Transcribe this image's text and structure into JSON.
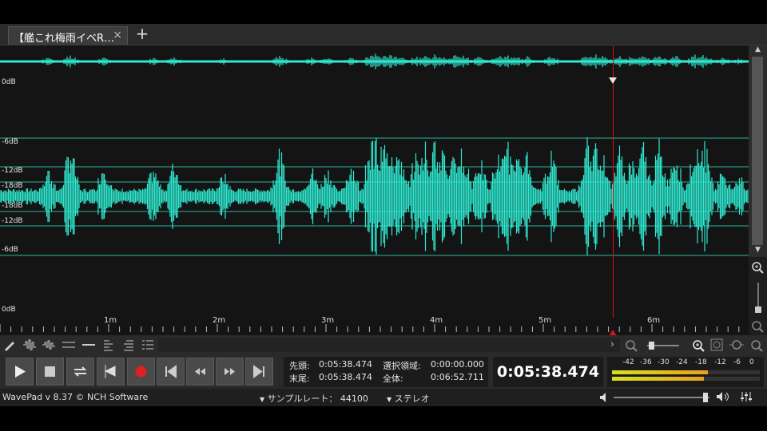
{
  "tabs": [
    {
      "label": "【艦これ梅雨イベR…",
      "close": "×"
    }
  ],
  "add_tab": "+",
  "db_labels": {
    "top_0db": "0dB",
    "neg6_upper": "-6dB",
    "neg12_upper": "-12dB",
    "neg18_upper": "-18dB",
    "neg18_lower": "-18dB",
    "neg12_lower": "-12dB",
    "neg6_lower": "-6dB",
    "bottom_0db": "0dB"
  },
  "ruler": {
    "marks": [
      "1m",
      "2m",
      "3m",
      "4m",
      "5m",
      "6m"
    ]
  },
  "info": {
    "start_label": "先頭:",
    "start_value": "0:05:38.474",
    "end_label": "末尾:",
    "end_value": "0:05:38.474",
    "selection_label": "選択領域:",
    "selection_value": "0:00:00.000",
    "total_label": "全体:",
    "total_value": "0:06:52.711"
  },
  "current_time": "0:05:38.474",
  "meter_scale": [
    "-42",
    "-36",
    "-30",
    "-24",
    "-18",
    "-12",
    "-6",
    "0"
  ],
  "status": {
    "app": "WavePad v 8.37 © NCH Software",
    "sample_rate_label": "サンプルレート：",
    "sample_rate_value": "44100",
    "channel": "ステレオ"
  },
  "colors": {
    "waveform": "#2ee8d0",
    "playhead": "#e01010",
    "meter_fill": "#e8a020",
    "meter_fill_low": "#d8e020",
    "record": "#e02020"
  }
}
